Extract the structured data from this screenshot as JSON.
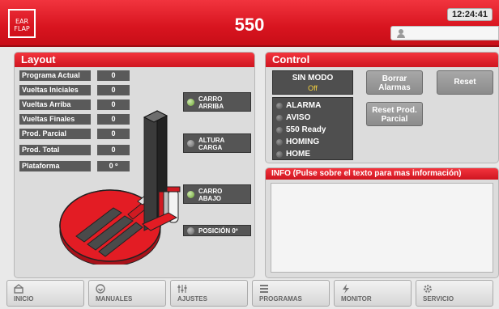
{
  "header": {
    "logo_line1": "EAR",
    "logo_line2": "FLAP",
    "title": "550",
    "time": "12:24:41"
  },
  "layout_panel": {
    "title": "Layout",
    "stats": [
      {
        "label": "Programa Actual",
        "value": "0"
      },
      {
        "label": "Vueltas Iniciales",
        "value": "0"
      },
      {
        "label": "Vueltas Arriba",
        "value": "0"
      },
      {
        "label": "Vueltas Finales",
        "value": "0"
      },
      {
        "label": "Prod. Parcial",
        "value": "0"
      },
      {
        "label": "Prod. Total",
        "value": "0"
      },
      {
        "label": "Plataforma",
        "value": "0 º"
      }
    ],
    "tags": {
      "carro_arriba_1": "CARRO",
      "carro_arriba_2": "ARRIBA",
      "altura_carga_1": "ALTURA",
      "altura_carga_2": "CARGA",
      "carro_abajo_1": "CARRO",
      "carro_abajo_2": "ABAJO",
      "posicion": "POSICIÓN 0º"
    }
  },
  "control_panel": {
    "title": "Control",
    "mode_label": "SIN MODO",
    "mode_sub": "Off",
    "alarms": [
      "ALARMA",
      "AVISO",
      "550 Ready",
      "HOMING",
      "HOME"
    ],
    "btn_borrar_1": "Borrar",
    "btn_borrar_2": "Alarmas",
    "btn_reset": "Reset",
    "btn_resetprod_1": "Reset Prod.",
    "btn_resetprod_2": "Parcial"
  },
  "info_panel": {
    "title": "INFO (Pulse sobre el texto para mas información)"
  },
  "nav": {
    "inicio": "INICIO",
    "manuales": "MANUALES",
    "ajustes": "AJUSTES",
    "programas": "PROGRAMAS",
    "monitor": "MONITOR",
    "servicio": "SERVICIO"
  },
  "colors": {
    "brand_red": "#d8141f",
    "panel_bg": "#dcdcdc",
    "led_on": "#6aa52c",
    "mode_sub": "#f6d23e"
  }
}
